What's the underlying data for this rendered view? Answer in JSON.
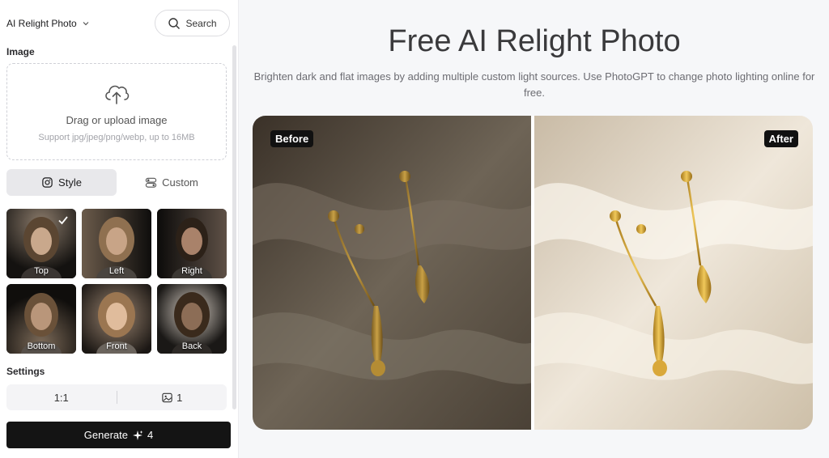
{
  "sidebar": {
    "tool_name": "AI Relight Photo",
    "search_label": "Search",
    "image_section_label": "Image",
    "upload": {
      "title": "Drag or upload image",
      "subtitle": "Support jpg/jpeg/png/webp, up to 16MB"
    },
    "mode_tabs": [
      {
        "label": "Style",
        "icon": "instagram-icon",
        "active": true
      },
      {
        "label": "Custom",
        "icon": "toggle-icon",
        "active": false
      }
    ],
    "styles": [
      {
        "label": "Top",
        "selected": true
      },
      {
        "label": "Left",
        "selected": false
      },
      {
        "label": "Right",
        "selected": false
      },
      {
        "label": "Bottom",
        "selected": false
      },
      {
        "label": "Front",
        "selected": false
      },
      {
        "label": "Back",
        "selected": false
      }
    ],
    "settings_label": "Settings",
    "settings": {
      "aspect_ratio": "1:1",
      "image_count": "1"
    },
    "generate": {
      "label": "Generate",
      "credits": "4"
    }
  },
  "main": {
    "title": "Free AI Relight Photo",
    "subtitle": "Brighten dark and flat images by adding multiple custom light sources. Use PhotoGPT to change photo lighting online for free.",
    "compare": {
      "before_label": "Before",
      "after_label": "After"
    }
  },
  "colors": {
    "accent": "#141414",
    "background": "#f6f7f9",
    "active_tab": "#e8e8eb"
  }
}
